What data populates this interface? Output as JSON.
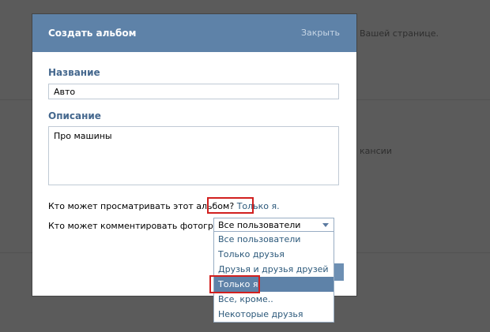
{
  "background": {
    "text_right_1": "Вашей странице.",
    "text_right_2": "кансии"
  },
  "modal": {
    "title": "Создать альбом",
    "close_label": "Закрыть",
    "name_label": "Название",
    "name_value": "Авто",
    "description_label": "Описание",
    "description_value": "Про машины",
    "view_permission_label": "Кто может просматривать этот альбом?",
    "view_permission_value": "Только я.",
    "comment_permission_label": "Кто может комментировать фотографии?"
  },
  "dropdown": {
    "selected": "Все пользователи",
    "options": [
      "Все пользователи",
      "Только друзья",
      "Друзья и друзья друзей",
      "Только я",
      "Все, кроме..",
      "Некоторые друзья"
    ],
    "highlighted_index": 3
  },
  "colors": {
    "header": "#5e82a8",
    "highlight_box": "#d1201f",
    "link": "#2b587a"
  }
}
